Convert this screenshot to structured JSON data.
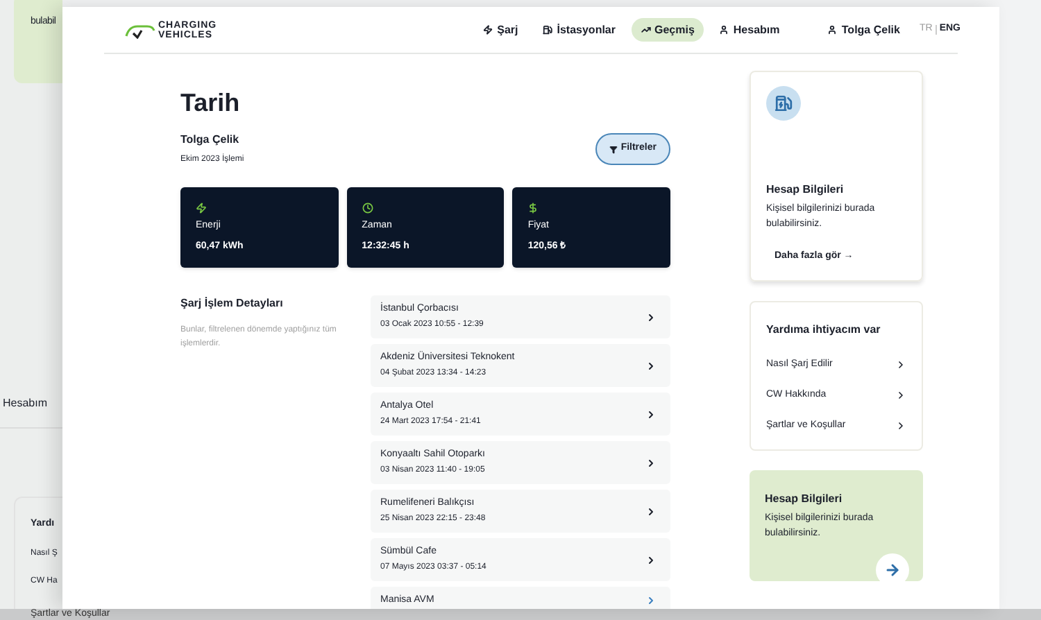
{
  "background_window": {
    "banner_text": "bulabil",
    "nav_item": "Hesabım",
    "help_title": "Yardı",
    "help_links": [
      "Nasıl Ş",
      "CW Ha",
      "Şartlar ve Koşullar"
    ]
  },
  "header": {
    "logo": {
      "line1": "CHARGING",
      "line2": "VEHICLES"
    },
    "nav": [
      {
        "label": "Şarj",
        "selected": false
      },
      {
        "label": "İstasyonlar",
        "selected": false
      },
      {
        "label": "Geçmiş",
        "selected": true
      },
      {
        "label": "Hesabım",
        "selected": false
      }
    ],
    "user": "Tolga Çelik",
    "languages": [
      {
        "label": "TR",
        "selected": false
      },
      {
        "label": "ENG",
        "selected": true
      }
    ]
  },
  "page": {
    "title": "Tarih",
    "user_name": "Tolga Çelik",
    "period": "Ekim 2023 İşlemi",
    "filter_button": "Filtreler"
  },
  "stats": [
    {
      "kind": "energy",
      "label": "Enerji",
      "value": "60,47 kWh"
    },
    {
      "kind": "time",
      "label": "Zaman",
      "value": "12:32:45 h"
    },
    {
      "kind": "price",
      "label": "Fiyat",
      "value": "120,56 ₺"
    }
  ],
  "details": {
    "title": "Şarj İşlem Detayları",
    "description": "Bunlar, filtrelenen dönemde yaptığınız tüm işlemlerdir."
  },
  "transactions": [
    {
      "name": "İstanbul Çorbacısı",
      "time": "03 Ocak 2023 10:55 - 12:39"
    },
    {
      "name": "Akdeniz Üniversitesi Teknokent",
      "time": "04 Şubat 2023 13:34 - 14:23"
    },
    {
      "name": "Antalya Otel",
      "time": "24 Mart 2023 17:54 - 21:41"
    },
    {
      "name": "Konyaaltı Sahil Otoparkı",
      "time": "03 Nisan 2023 11:40 - 19:05"
    },
    {
      "name": "Rumelifeneri Balıkçısı",
      "time": "25 Nisan 2023 22:15 - 23:48"
    },
    {
      "name": "Sümbül Cafe",
      "time": "07 Mayıs 2023 03:37 - 05:14"
    },
    {
      "name": "Manisa AVM"
    }
  ],
  "sidebar": {
    "account_card": {
      "title": "Hesap Bilgileri",
      "text": "Kişisel bilgilerinizi burada bulabilirsiniz.",
      "link": "Daha fazla gör →"
    },
    "help": {
      "title": "Yardıma ihtiyacım var",
      "links": [
        "Nasıl Şarj Edilir",
        "CW Hakkında",
        "Şartlar ve Koşullar"
      ]
    },
    "promo": {
      "title": "Hesap Bilgileri",
      "text": "Kişisel bilgilerinizi burada bulabilirsiniz."
    }
  }
}
